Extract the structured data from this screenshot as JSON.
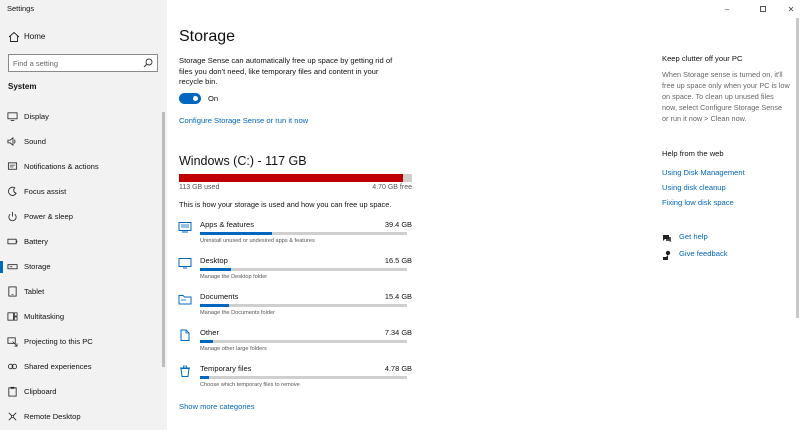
{
  "window": {
    "title": "Settings",
    "minimize": "–",
    "close": "✕"
  },
  "sidebar": {
    "home_label": "Home",
    "search_placeholder": "Find a setting",
    "section": "System",
    "items": [
      {
        "label": "Display",
        "icon": "display-icon"
      },
      {
        "label": "Sound",
        "icon": "sound-icon"
      },
      {
        "label": "Notifications & actions",
        "icon": "notifications-icon"
      },
      {
        "label": "Focus assist",
        "icon": "focus-assist-icon"
      },
      {
        "label": "Power & sleep",
        "icon": "power-icon"
      },
      {
        "label": "Battery",
        "icon": "battery-icon"
      },
      {
        "label": "Storage",
        "icon": "storage-icon",
        "selected": true
      },
      {
        "label": "Tablet",
        "icon": "tablet-icon"
      },
      {
        "label": "Multitasking",
        "icon": "multitasking-icon"
      },
      {
        "label": "Projecting to this PC",
        "icon": "projecting-icon"
      },
      {
        "label": "Shared experiences",
        "icon": "shared-experiences-icon"
      },
      {
        "label": "Clipboard",
        "icon": "clipboard-icon"
      },
      {
        "label": "Remote Desktop",
        "icon": "remote-desktop-icon"
      }
    ]
  },
  "main": {
    "title": "Storage",
    "description": "Storage Sense can automatically free up space by getting rid of files you don't need, like temporary files and content in your recycle bin.",
    "toggle_label": "On",
    "configure_link": "Configure Storage Sense or run it now",
    "drive": {
      "title": "Windows (C:) - 117 GB",
      "used": "113 GB used",
      "free": "4.70 GB free",
      "used_fraction": 0.96
    },
    "usage_text": "This is how your storage is used and how you can free up space.",
    "categories": [
      {
        "name": "Apps & features",
        "size": "39.4 GB",
        "sub": "Uninstall unused or undesired apps & features",
        "fraction": 0.35,
        "icon": "apps-icon"
      },
      {
        "name": "Desktop",
        "size": "16.5 GB",
        "sub": "Manage the Desktop folder",
        "fraction": 0.15,
        "icon": "desktop-icon"
      },
      {
        "name": "Documents",
        "size": "15.4 GB",
        "sub": "Manage the Documents folder",
        "fraction": 0.14,
        "icon": "documents-icon"
      },
      {
        "name": "Other",
        "size": "7.34 GB",
        "sub": "Manage other large folders",
        "fraction": 0.065,
        "icon": "other-icon"
      },
      {
        "name": "Temporary files",
        "size": "4.78 GB",
        "sub": "Choose which temporary files to remove",
        "fraction": 0.045,
        "icon": "trash-icon"
      }
    ],
    "more_link": "Show more categories"
  },
  "right": {
    "clutter_title": "Keep clutter off your PC",
    "clutter_text": "When Storage sense is turned on, it'll free up space only when your PC is low on space. To clean up unused files now, select Configure Storage Sense or run it now > Clean now.",
    "help_title": "Help from the web",
    "links": [
      "Using Disk Management",
      "Using disk cleanup",
      "Fixing low disk space"
    ],
    "get_help": "Get help",
    "give_feedback": "Give feedback"
  },
  "colors": {
    "accent": "#0067c0",
    "drive_fill": "#c00000",
    "sidebar_bg": "#f2f2f2"
  }
}
